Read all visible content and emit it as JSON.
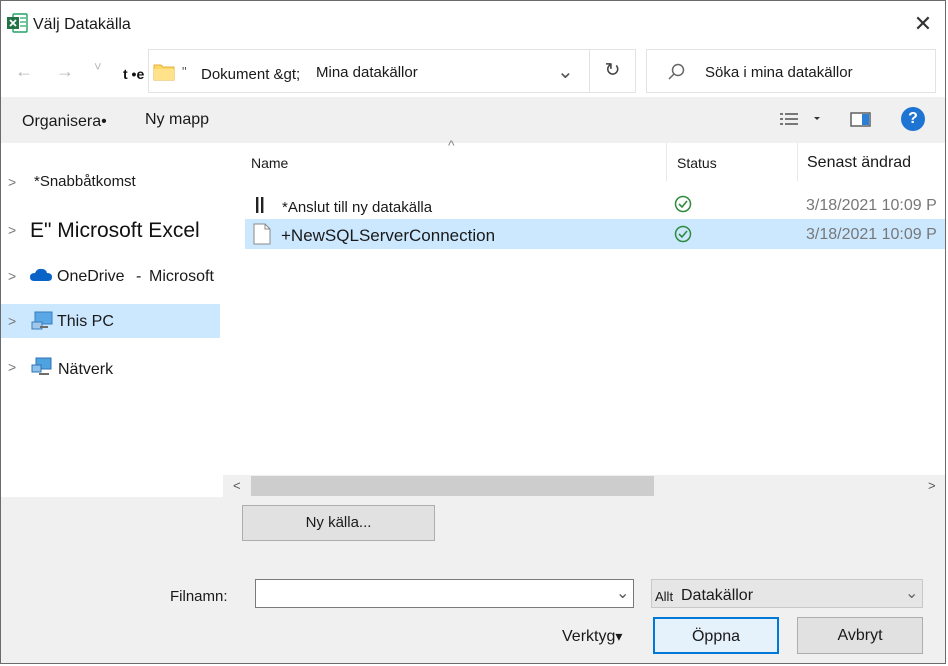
{
  "window": {
    "title": "Välj Datakälla",
    "close_glyph": "✕",
    "app_icon": "excel-icon"
  },
  "nav": {
    "back_glyph": "←",
    "forward_glyph": "→",
    "recent_glyph": "˅",
    "path_fragment": "t •e",
    "address_quote": "\"",
    "address_segment_1": "Dokument &gt;",
    "address_segment_2": "Mina datakällor",
    "dropdown_glyph": "⌄",
    "refresh_glyph": "↻",
    "search_placeholder": "Söka i mina datakällor"
  },
  "toolbar": {
    "organize_label": "Organisera•",
    "new_folder_label": "Ny mapp",
    "help_glyph": "?"
  },
  "sidebar": {
    "items": [
      {
        "label": "*Snabbåtkomst",
        "icon": "star-icon"
      },
      {
        "label": "E\" Microsoft Excel",
        "icon": "excel-icon"
      },
      {
        "label_a": "OneDrive",
        "label_sep": "-",
        "label_b": "Microsoft",
        "icon": "cloud-icon"
      },
      {
        "label": "This PC",
        "icon": "computer-icon",
        "selected": true
      },
      {
        "label": "Nätverk",
        "icon": "network-icon"
      }
    ]
  },
  "file_list": {
    "columns": [
      "Name",
      "Status",
      "Senast ändrad"
    ],
    "sort_glyph": "^",
    "rows": [
      {
        "name": "*Anslut till ny datakälla",
        "status": "synced",
        "modified": "3/18/2021 10:09 P",
        "icon": "connect-icon"
      },
      {
        "name": "+NewSQLServerConnection",
        "status": "synced",
        "modified": "3/18/2021 10:09 P",
        "icon": "file-icon",
        "selected": true
      }
    ]
  },
  "scrollbar": {
    "left_glyph": "<",
    "right_glyph": ">",
    "thumb_fraction": 0.6
  },
  "footer": {
    "new_source_label": "Ny källa...",
    "filename_label": "Filnamn:",
    "filename_value": "",
    "filetype_prefix": "Allt",
    "filetype_value": "Datakällor",
    "tools_label": "Verktyg",
    "tools_glyph": "▾",
    "open_label": "Öppna",
    "cancel_label": "Avbryt"
  },
  "colors": {
    "selection": "#cce8ff",
    "accent": "#0078d7",
    "excel_green": "#217346",
    "status_green": "#2e8b3e"
  }
}
